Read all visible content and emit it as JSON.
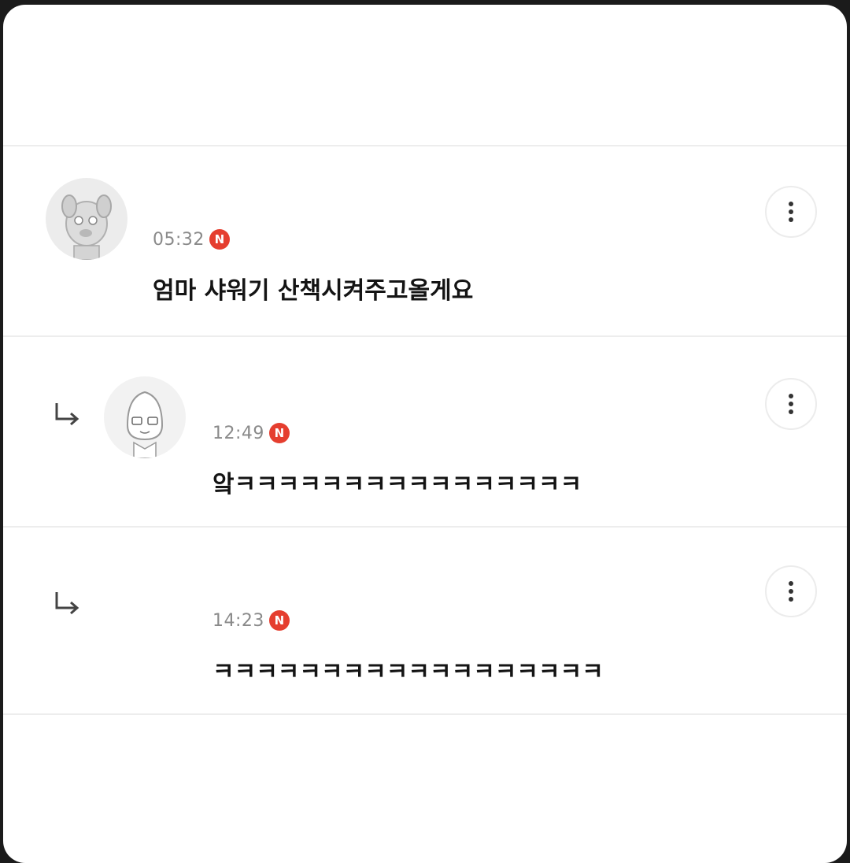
{
  "comments": [
    {
      "time": "05:32",
      "badge": "N",
      "text": "엄마 샤워기 산책시켜주고올게요",
      "icon": "dog-avatar",
      "more_icon": "more-vertical-icon"
    },
    {
      "time": "12:49",
      "badge": "N",
      "text": "앜ㅋㅋㅋㅋㅋㅋㅋㅋㅋㅋㅋㅋㅋㅋㅋㅋ",
      "icon": "peach-avatar",
      "reply_icon": "reply-arrow-icon",
      "more_icon": "more-vertical-icon"
    },
    {
      "time": "14:23",
      "badge": "N",
      "text": "ㅋㅋㅋㅋㅋㅋㅋㅋㅋㅋㅋㅋㅋㅋㅋㅋㅋㅋ",
      "reply_icon": "reply-arrow-icon",
      "more_icon": "more-vertical-icon"
    }
  ],
  "colors": {
    "badge": "#e53e2f",
    "time": "#8a8a8a",
    "text": "#141414",
    "divider": "#ededed"
  }
}
